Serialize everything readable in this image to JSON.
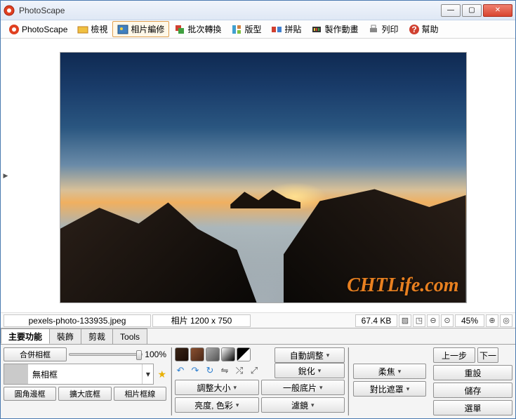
{
  "window": {
    "title": "PhotoScape"
  },
  "toolbar": {
    "tabs": [
      {
        "label": "PhotoScape"
      },
      {
        "label": "檢視"
      },
      {
        "label": "相片編修"
      },
      {
        "label": "批次轉換"
      },
      {
        "label": "版型"
      },
      {
        "label": "拼貼"
      },
      {
        "label": "製作動畫"
      },
      {
        "label": "列印"
      },
      {
        "label": "幫助"
      }
    ]
  },
  "status": {
    "filename": "pexels-photo-133935.jpeg",
    "dimensions": "相片 1200 x 750",
    "filesize": "67.4 KB",
    "zoom": "45%"
  },
  "watermark": "CHTLife.com",
  "edit_tabs": [
    "主要功能",
    "裝飾",
    "剪裁",
    "Tools"
  ],
  "left_panel": {
    "merge_frame": "合併相框",
    "slider_pct": "100%",
    "no_frame": "無相框",
    "round_frame": "圓角邊框",
    "expand_frame": "擴大底框",
    "photo_border": "相片框線"
  },
  "mid_panel": {
    "resize": "調整大小",
    "brightness": "亮度, 色彩"
  },
  "right_panel": {
    "auto_adjust": "自動調整",
    "sharpen": "銳化",
    "normal_film": "一般底片",
    "filter": "濾鏡",
    "soft_focus": "柔焦",
    "contrast_mask": "對比遮罩"
  },
  "far_panel": {
    "undo": "上一步",
    "redo": "下一",
    "reset": "重設",
    "save": "儲存",
    "menu": "選單"
  },
  "colors": {
    "swatches": [
      "#3a2416",
      "#6a4028",
      "#968070",
      "#d4d4d4",
      "#202020"
    ]
  },
  "icons": {
    "rotate_left": "↶",
    "rotate_right": "↷",
    "flip_h": "⇋",
    "flip_v": "⤭",
    "crop": "▧",
    "expand": "⤢"
  }
}
